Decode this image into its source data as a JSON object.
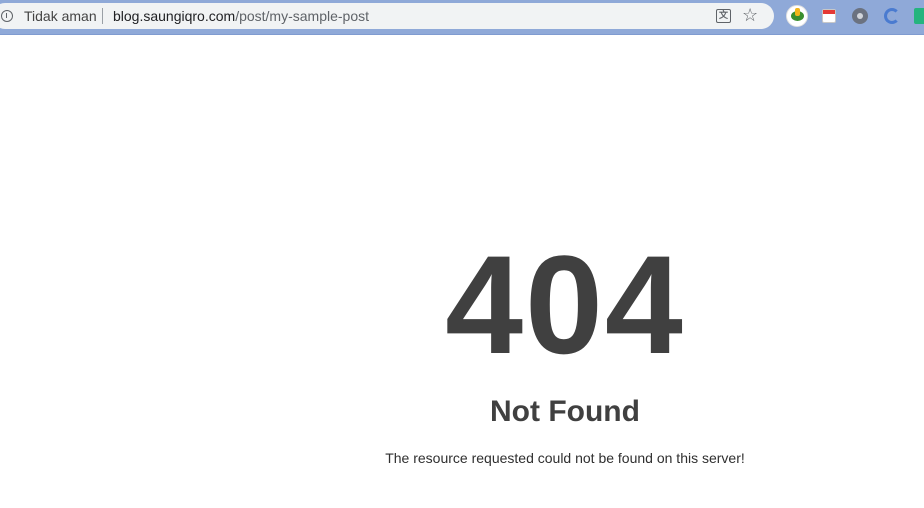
{
  "browser": {
    "security_label": "Tidak aman",
    "url_host": "blog.saungiqro.com",
    "url_path": "/post/my-sample-post",
    "extensions": [
      "idm-icon",
      "calendar-icon",
      "gear-icon",
      "sync-icon",
      "green-extension-icon"
    ],
    "colors": {
      "toolbar": "#8fa9d8",
      "omnibox": "#f1f3f4"
    }
  },
  "page": {
    "code": "404",
    "title": "Not Found",
    "message": "The resource requested could not be found on this server!",
    "text_color": "#404040"
  }
}
